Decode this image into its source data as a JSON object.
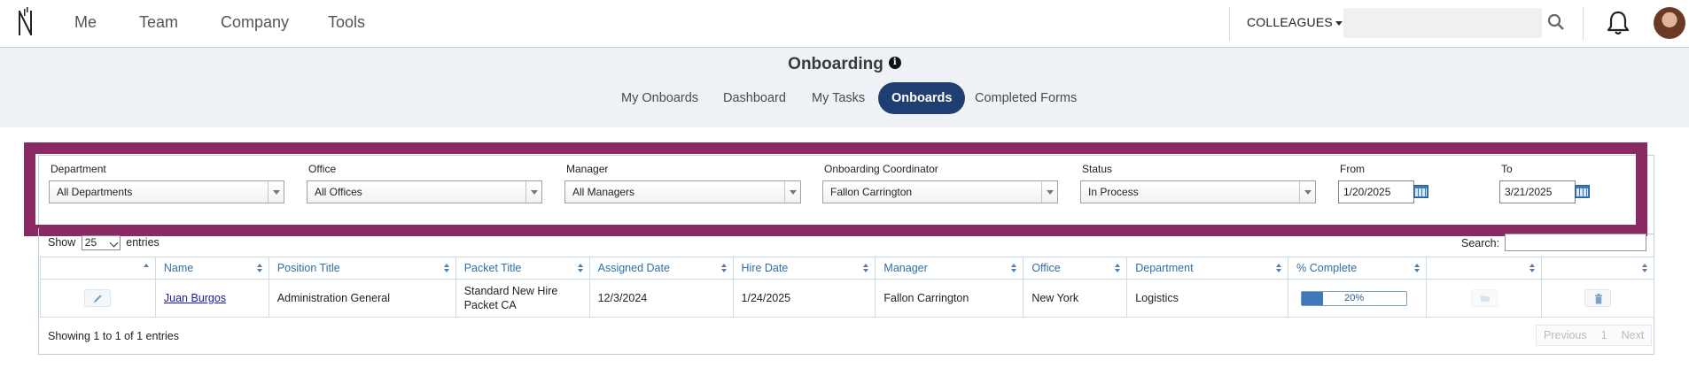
{
  "nav": {
    "items": [
      "Me",
      "Team",
      "Company",
      "Tools"
    ],
    "colleagues_label": "COLLEAGUES",
    "search_placeholder": ""
  },
  "header": {
    "title": "Onboarding",
    "tabs": [
      "My Onboards",
      "Dashboard",
      "My Tasks",
      "Onboards",
      "Completed Forms"
    ],
    "active_tab": "Onboards"
  },
  "filters": {
    "department": {
      "label": "Department",
      "value": "All Departments"
    },
    "office": {
      "label": "Office",
      "value": "All Offices"
    },
    "manager": {
      "label": "Manager",
      "value": "All Managers"
    },
    "coordinator": {
      "label": "Onboarding Coordinator",
      "value": "Fallon Carrington"
    },
    "status": {
      "label": "Status",
      "value": "In Process"
    },
    "from": {
      "label": "From",
      "value": "1/20/2025"
    },
    "to": {
      "label": "To",
      "value": "3/21/2025"
    }
  },
  "table": {
    "show_label": "Show",
    "entries_value": "25",
    "entries_label": "entries",
    "search_label": "Search:",
    "columns": [
      "",
      "Name",
      "Position Title",
      "Packet Title",
      "Assigned Date",
      "Hire Date",
      "Manager",
      "Office",
      "Department",
      "% Complete",
      "",
      ""
    ],
    "rows": [
      {
        "name": "Juan Burgos",
        "position": "Administration General",
        "packet_line1": "Standard New Hire",
        "packet_line2": "Packet CA",
        "assigned": "12/3/2024",
        "hire": "1/24/2025",
        "manager": "Fallon Carrington",
        "office": "New York",
        "department": "Logistics",
        "complete_text": "20%",
        "complete_fraction": 0.2
      }
    ],
    "showing": "Showing 1 to 1 of 1 entries",
    "pager": {
      "previous": "Previous",
      "page": "1",
      "next": "Next"
    }
  },
  "colors": {
    "accent": "#1f3f72",
    "frame": "#8b2a62",
    "header_text": "#2f6ea6",
    "progress": "#3d78b8"
  }
}
